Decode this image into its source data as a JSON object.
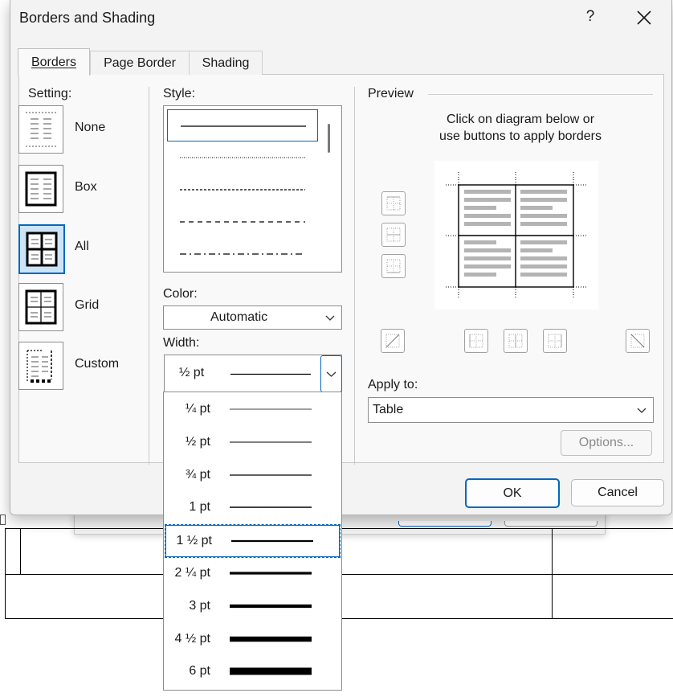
{
  "dialog": {
    "title": "Borders and Shading",
    "help_label": "?",
    "tabs": [
      {
        "label": "Borders",
        "active": true
      },
      {
        "label": "Page Border",
        "active": false
      },
      {
        "label": "Shading",
        "active": false
      }
    ]
  },
  "setting": {
    "label": "Setting:",
    "items": [
      {
        "label": "None",
        "icon": "setting-none-icon"
      },
      {
        "label": "Box",
        "icon": "setting-box-icon"
      },
      {
        "label": "All",
        "icon": "setting-all-icon",
        "selected": true
      },
      {
        "label": "Grid",
        "icon": "setting-grid-icon"
      },
      {
        "label": "Custom",
        "icon": "setting-custom-icon"
      }
    ]
  },
  "style": {
    "label": "Style:"
  },
  "color": {
    "label": "Color:",
    "value": "Automatic"
  },
  "width": {
    "label": "Width:",
    "value": "½ pt",
    "options": [
      "¼ pt",
      "½ pt",
      "¾ pt",
      "1 pt",
      "1 ½ pt",
      "2 ¼ pt",
      "3 pt",
      "4 ½ pt",
      "6 pt"
    ],
    "highlighted_option": "1 ½ pt"
  },
  "preview": {
    "label": "Preview",
    "instruction_line1": "Click on diagram below or",
    "instruction_line2": "use buttons to apply borders"
  },
  "apply_to": {
    "label": "Apply to:",
    "value": "Table"
  },
  "buttons": {
    "options": "Options...",
    "ok": "OK",
    "cancel": "Cancel"
  },
  "colors": {
    "accent": "#0067c0",
    "dialog_bg": "#f3f3f3",
    "panel_bg": "#f9f9f9"
  }
}
